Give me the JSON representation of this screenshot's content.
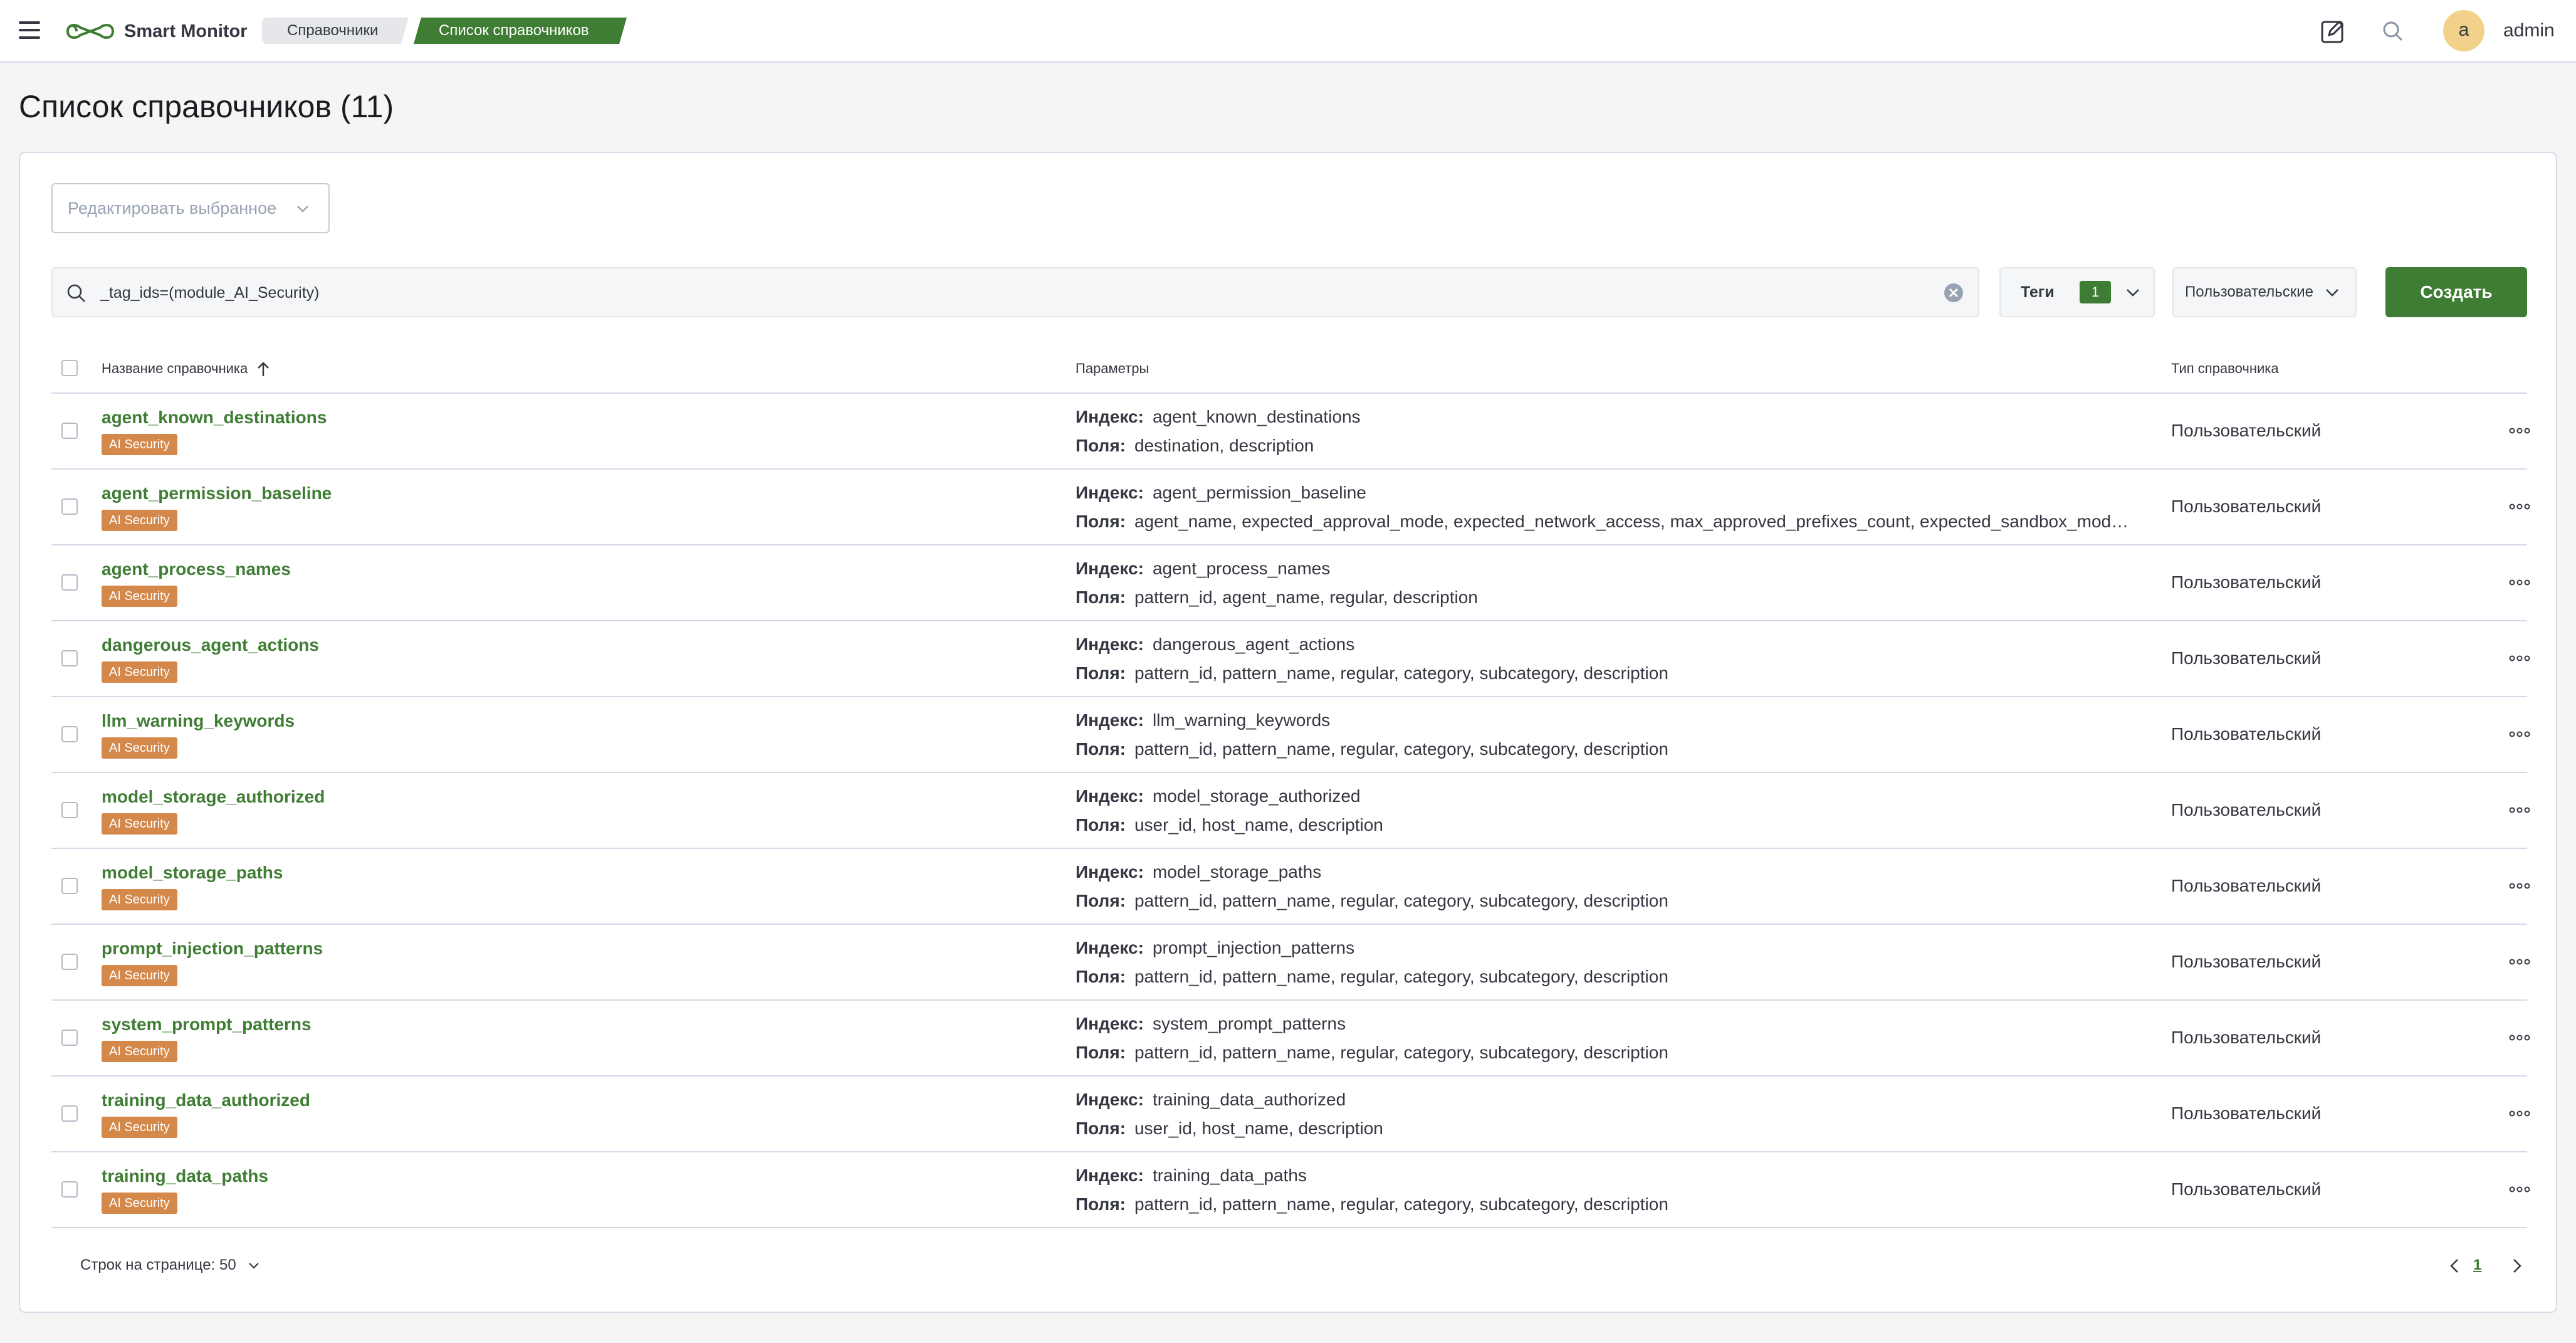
{
  "header": {
    "app_name": "Smart Monitor",
    "breadcrumbs": [
      "Справочники",
      "Список справочников"
    ],
    "user": {
      "initial": "a",
      "name": "admin"
    }
  },
  "page": {
    "title": "Список справочников (11)"
  },
  "toolbar": {
    "bulk_edit_label": "Редактировать выбранное",
    "search_value": "_tag_ids=(module_AI_Security)",
    "tags_label": "Теги",
    "tags_count": "1",
    "type_filter_label": "Пользовательские",
    "create_label": "Создать"
  },
  "table": {
    "columns": {
      "name": "Название справочника",
      "params": "Параметры",
      "type": "Тип справочника"
    },
    "index_label": "Индекс:",
    "fields_label": "Поля:",
    "rows": [
      {
        "name": "agent_known_destinations",
        "tag": "AI Security",
        "index": "agent_known_destinations",
        "fields": "destination, description",
        "type": "Пользовательский"
      },
      {
        "name": "agent_permission_baseline",
        "tag": "AI Security",
        "index": "agent_permission_baseline",
        "fields": "agent_name, expected_approval_mode, expected_network_access, max_approved_prefixes_count, expected_sandbox_mode, ex...",
        "type": "Пользовательский"
      },
      {
        "name": "agent_process_names",
        "tag": "AI Security",
        "index": "agent_process_names",
        "fields": "pattern_id, agent_name, regular, description",
        "type": "Пользовательский"
      },
      {
        "name": "dangerous_agent_actions",
        "tag": "AI Security",
        "index": "dangerous_agent_actions",
        "fields": "pattern_id, pattern_name, regular, category, subcategory, description",
        "type": "Пользовательский"
      },
      {
        "name": "llm_warning_keywords",
        "tag": "AI Security",
        "index": "llm_warning_keywords",
        "fields": "pattern_id, pattern_name, regular, category, subcategory, description",
        "type": "Пользовательский"
      },
      {
        "name": "model_storage_authorized",
        "tag": "AI Security",
        "index": "model_storage_authorized",
        "fields": "user_id, host_name, description",
        "type": "Пользовательский"
      },
      {
        "name": "model_storage_paths",
        "tag": "AI Security",
        "index": "model_storage_paths",
        "fields": "pattern_id, pattern_name, regular, category, subcategory, description",
        "type": "Пользовательский"
      },
      {
        "name": "prompt_injection_patterns",
        "tag": "AI Security",
        "index": "prompt_injection_patterns",
        "fields": "pattern_id, pattern_name, regular, category, subcategory, description",
        "type": "Пользовательский"
      },
      {
        "name": "system_prompt_patterns",
        "tag": "AI Security",
        "index": "system_prompt_patterns",
        "fields": "pattern_id, pattern_name, regular, category, subcategory, description",
        "type": "Пользовательский"
      },
      {
        "name": "training_data_authorized",
        "tag": "AI Security",
        "index": "training_data_authorized",
        "fields": "user_id, host_name, description",
        "type": "Пользовательский"
      },
      {
        "name": "training_data_paths",
        "tag": "AI Security",
        "index": "training_data_paths",
        "fields": "pattern_id, pattern_name, regular, category, subcategory, description",
        "type": "Пользовательский"
      }
    ]
  },
  "footer": {
    "rows_per_page": "Строк на странице: 50",
    "current_page": "1"
  },
  "colors": {
    "brand_green": "#3f7d34",
    "tag_orange": "#d4884a",
    "avatar_bg": "#f2d28a"
  }
}
